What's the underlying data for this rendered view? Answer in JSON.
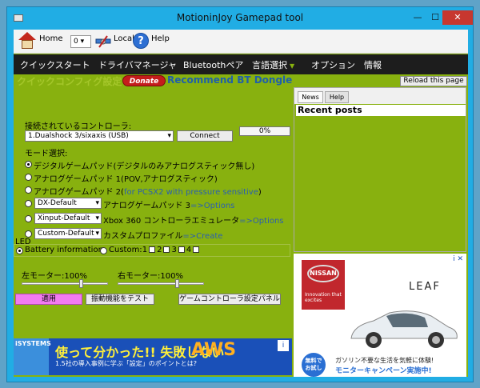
{
  "window": {
    "title": "MotioninJoy Gamepad tool",
    "min": "—",
    "max": "☐",
    "close": "✕"
  },
  "toolbar": {
    "home_label": "Home",
    "home_select": "0",
    "local_label": "Local",
    "help_label": "Help"
  },
  "menu": {
    "items": [
      "クイックスタート",
      "ドライバマネージャ",
      "Bluetoothペア",
      "言語選択",
      "オプション",
      "情報"
    ]
  },
  "header": {
    "title": "クイックコンフィグ設定",
    "donate": "Donate",
    "recommend": "Recommend BT Dongle",
    "reload": "Reload this page"
  },
  "controller": {
    "label": "接続されているコントローラ:",
    "selected": "1.Dualshock 3/sixaxis (USB)",
    "connect_button": "Connect",
    "progress": "0%"
  },
  "mode": {
    "label": "モード選択:",
    "opt1": "デジタルゲームパッド(デジタルのみアナログスティック無し)",
    "opt2": "アナログゲームパッド 1(POV,アナログスティック)",
    "opt3_main": "アナログゲームパッド 2(",
    "opt3_link": "for PCSX2 with pressure sensitive",
    "opt3_end": ")",
    "opt4_combo": "DX-Default",
    "opt4_text": "アナログゲームパッド 3",
    "opt4_link": "=>Options",
    "opt5_combo": "Xinput-Default",
    "opt5_text": "Xbox 360 コントローラエミュレータ",
    "opt5_link": "=>Options",
    "opt6_combo": "Custom-Default",
    "opt6_text": "カスタムプロファイル",
    "opt6_link": "=>Create"
  },
  "led": {
    "label": "LED",
    "battery": "Battery information",
    "custom": "Custom:",
    "n1": "1",
    "n2": "2",
    "n3": "3",
    "n4": "4"
  },
  "motors": {
    "left_label": "左モーター:100%",
    "right_label": "右モーター:100%",
    "left_value": 100,
    "right_value": 100
  },
  "actions": {
    "apply": "適用",
    "test_vibration": "振動機能をテスト",
    "game_controller_panel": "ゲームコントローラ設定パネル"
  },
  "ad_bottom": {
    "brand": "iSYSTEMS",
    "headline": "使って分かった!! 失敗しない",
    "aws": "AWS",
    "sub": "1.5社の導入事例に学ぶ「設定」のポイントとは?",
    "corner": "i"
  },
  "news_panel": {
    "tab_news": "News",
    "tab_help": "Help",
    "recent_posts": "Recent posts"
  },
  "ad_right": {
    "brand": "NISSAN",
    "tagline": "Innovation that excites",
    "model": "LEAF",
    "free_badge": "無料で お試し",
    "line1": "ガソリン不要な生活を気軽に体験!",
    "line2": "モニターキャンペーン実施中!",
    "corner": "i ✕"
  }
}
